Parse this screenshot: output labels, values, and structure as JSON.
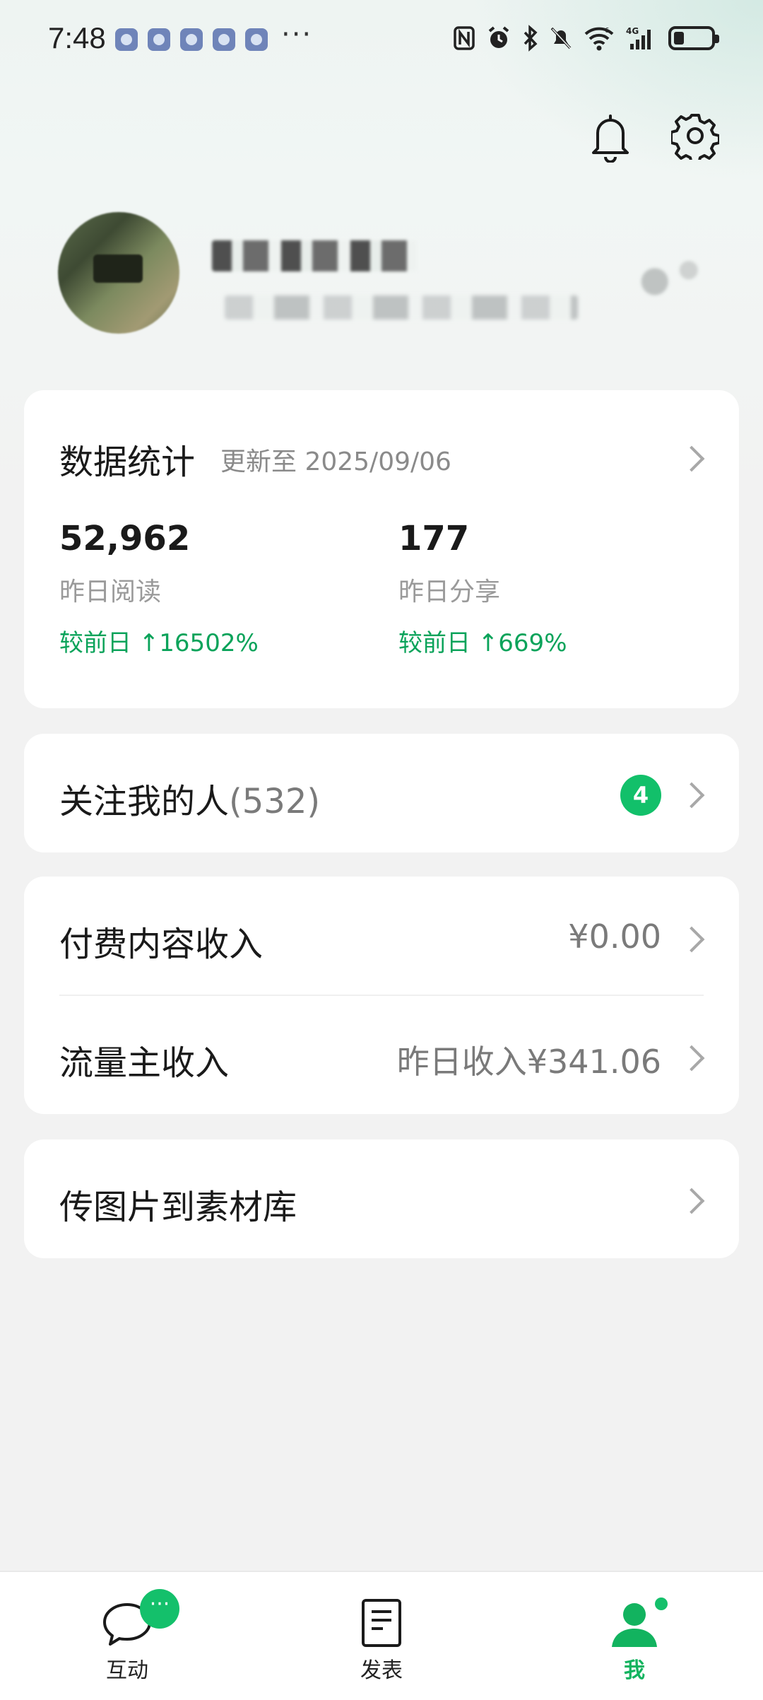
{
  "status_bar": {
    "time": "7:48",
    "more": "···"
  },
  "header": {
    "bell_icon": "bell-icon",
    "settings_icon": "gear-icon"
  },
  "stats": {
    "title": "数据统计",
    "updated": "更新至 2025/09/06",
    "items": [
      {
        "value": "52,962",
        "label": "昨日阅读",
        "change": "较前日 ↑16502%"
      },
      {
        "value": "177",
        "label": "昨日分享",
        "change": "较前日 ↑669%"
      }
    ]
  },
  "followers": {
    "label": "关注我的人",
    "count": "(532)",
    "badge": "4"
  },
  "income": {
    "paid_label": "付费内容收入",
    "paid_value": "¥0.00",
    "traffic_label": "流量主收入",
    "traffic_value": "昨日收入¥341.06"
  },
  "upload": {
    "label": "传图片到素材库"
  },
  "nav": {
    "items": [
      {
        "label": "互动",
        "icon": "chat-bubble-icon",
        "badge": "···"
      },
      {
        "label": "发表",
        "icon": "document-icon"
      },
      {
        "label": "我",
        "icon": "person-icon"
      }
    ]
  },
  "colors": {
    "accent": "#12c06a",
    "background": "#f2f2f2",
    "card": "#ffffff"
  }
}
